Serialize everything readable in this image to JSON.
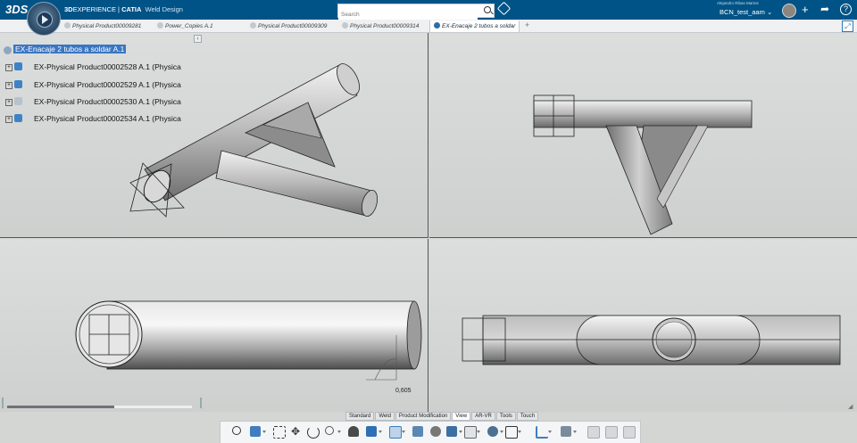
{
  "app": {
    "brand_prefix": "3D",
    "brand_suffix": "EXPERIENCE",
    "brand_product": "CATIA",
    "brand_app": "Weld Design",
    "logo_text": "3DS"
  },
  "search": {
    "placeholder": "Search"
  },
  "user": {
    "name": "Alejandro Ribas Martos",
    "tenant": "BCN_test_aam"
  },
  "tabs": [
    {
      "label": "Physical Product00009281"
    },
    {
      "label": "Power_Copies A.1"
    },
    {
      "label": "Physical Product00009309"
    },
    {
      "label": "Physical Product00009314"
    },
    {
      "label": "EX-Enacaje 2 tubos a soldar"
    }
  ],
  "tree": {
    "root": "EX-Enacaje 2 tubos a soldar A.1",
    "items": [
      {
        "label": "EX-Physical Product00002528 A.1 (Physica"
      },
      {
        "label": "EX-Physical Product00002529 A.1 (Physica"
      },
      {
        "label": "EX-Physical Product00002530 A.1 (Physica"
      },
      {
        "label": "EX-Physical Product00002534 A.1 (Physica"
      }
    ]
  },
  "viewport": {
    "dimension_value": "0,605"
  },
  "section_tabs": [
    {
      "label": "Standard"
    },
    {
      "label": "Weld"
    },
    {
      "label": "Product Modification"
    },
    {
      "label": "View"
    },
    {
      "label": "AR-VR"
    },
    {
      "label": "Tools"
    },
    {
      "label": "Touch"
    }
  ],
  "active_section": "View",
  "colors": {
    "topbar": "#005386",
    "selection": "#3a76c2"
  },
  "toolbar_icons": [
    "zoom-icon",
    "view-cube-icon",
    "fit-all-icon",
    "pan-icon",
    "rotate-icon",
    "zoom-area-icon",
    "normal-view-icon",
    "render-style-icon",
    "ghosting-icon",
    "layers-icon",
    "hide-show-icon",
    "swap-visible-icon",
    "quick-view-icon",
    "compass-icon",
    "section-icon",
    "tree-icon",
    "capture-icon",
    "measure-icon",
    "annotations-icon",
    "tessellation-icon"
  ]
}
